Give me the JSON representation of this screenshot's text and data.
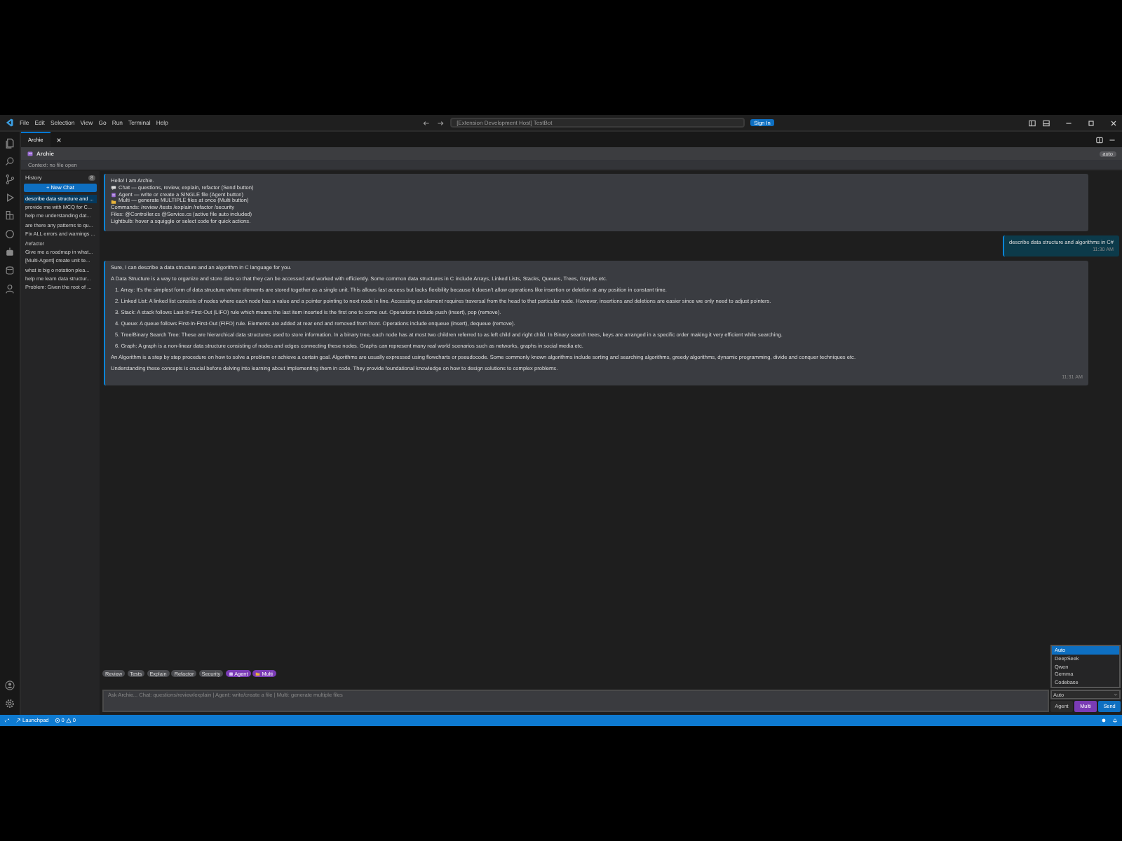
{
  "titlebar": {
    "menu": [
      "File",
      "Edit",
      "Selection",
      "View",
      "Go",
      "Run",
      "Terminal",
      "Help"
    ],
    "search": "[Extension Development Host] TestBot",
    "sign_in": "Sign In"
  },
  "tabs": [
    {
      "label": "Archie",
      "selected": true
    }
  ],
  "panel": {
    "title": "Archie",
    "badge": "auto",
    "context": "Context: no file open"
  },
  "history": {
    "title": "History",
    "count": "8",
    "new_chat": "+ New Chat",
    "items": [
      {
        "label": "describe data structure and ...",
        "selected": true
      },
      {
        "label": "provide me with MCQ for C...",
        "selected": false
      },
      {
        "label": "help me understanding dat...",
        "selected": false
      },
      {
        "label": "are there any patterns to qu...",
        "selected": false
      },
      {
        "label": "Fix ALL errors and warnings ...",
        "selected": false
      },
      {
        "label": "/refactor",
        "selected": false
      },
      {
        "label": "Give me a roadmap in what...",
        "selected": false
      },
      {
        "label": "[Multi-Agent] create unit te...",
        "selected": false
      },
      {
        "label": "what is big o notation plea...",
        "selected": false
      },
      {
        "label": "help me learn data structur...",
        "selected": false
      },
      {
        "label": "Problem: Given the root of ...",
        "selected": false
      }
    ]
  },
  "messages": [
    {
      "kind": "assistant",
      "lines": [
        {
          "kind": "text",
          "text": "Hello! I am Archie."
        },
        {
          "kind": "chat",
          "text": "Chat — questions, review, explain, refactor (Send button)"
        },
        {
          "kind": "agent",
          "text": "Agent — write or create a SINGLE file (Agent button)"
        },
        {
          "kind": "multi",
          "text": "Multi — generate MULTIPLE files at once (Multi button)"
        },
        {
          "kind": "text",
          "text": "Commands: /review /tests /explain /refactor /security"
        },
        {
          "kind": "text",
          "text": "Files: @Controller.cs @Service.cs (active file auto included)"
        },
        {
          "kind": "text",
          "text": "Lightbulb: hover a squiggle or select code for quick actions."
        }
      ]
    },
    {
      "kind": "user",
      "lines": [
        {
          "kind": "text",
          "text": "describe data structure and algorithms in C#"
        }
      ],
      "time": "11:30 AM"
    },
    {
      "kind": "assistant",
      "lines": [
        {
          "kind": "para",
          "text": "Sure, I can describe a data structure and an algorithm in C language for you."
        },
        {
          "kind": "para",
          "text": "A Data Structure is a way to organize and store data so that they can be accessed and worked with efficiently. Some common data structures in C include Arrays, Linked Lists, Stacks, Queues, Trees, Graphs etc."
        },
        {
          "kind": "item",
          "text": "1. Array: It's the simplest form of data structure where elements are stored together as a single unit. This allows fast access but lacks flexibility because it doesn’t allow operations like insertion or deletion at any position in constant time."
        },
        {
          "kind": "item",
          "text": "2. Linked List: A linked list consists of nodes where each node has a value and a pointer pointing to next node in line. Accessing an element requires traversal from the head to that particular node. However, insertions and deletions are easier since we only need to adjust pointers."
        },
        {
          "kind": "item",
          "text": "3. Stack: A stack follows Last-In-First-Out (LIFO) rule which means the last item inserted is the first one to come out. Operations include push (insert), pop (remove)."
        },
        {
          "kind": "item",
          "text": "4. Queue: A queue follows First-In-First-Out (FIFO) rule. Elements are added at rear end and removed from front. Operations include enqueue (insert), dequeue (remove)."
        },
        {
          "kind": "item",
          "text": "5. Tree/Binary Search Tree: These are hierarchical data structures used to store information. In a binary tree, each node has at most two children referred to as left child and right child. In Binary search trees, keys are arranged in a specific order making it very efficient while searching."
        },
        {
          "kind": "item",
          "text": "6. Graph: A graph is a non-linear data structure consisting of nodes and edges connecting these nodes. Graphs can represent many real world scenarios such as networks, graphs in social media etc."
        },
        {
          "kind": "para",
          "text": "An Algorithm is a step by step procedure on how to solve a problem or achieve a certain goal. Algorithms are usually expressed using flowcharts or pseudocode. Some commonly known algorithms include sorting and searching algorithms, greedy algorithms, dynamic programming, divide and conquer techniques etc."
        },
        {
          "kind": "para",
          "text": "Understanding these concepts is crucial before delving into learning about implementing them in code. They provide foundational knowledge on how to design solutions to complex problems."
        }
      ],
      "time": "11:31 AM"
    }
  ],
  "chips": [
    {
      "label": "Review",
      "kind": "plain"
    },
    {
      "label": "Tests",
      "kind": "plain"
    },
    {
      "label": "Explain",
      "kind": "plain"
    },
    {
      "label": "Refactor",
      "kind": "plain"
    },
    {
      "label": "Security",
      "kind": "plain"
    },
    {
      "label": "Agent",
      "kind": "agent"
    },
    {
      "label": "Multi",
      "kind": "multi"
    }
  ],
  "composer": {
    "placeholder": "Ask Archie... Chat: questions/review/explain | Agent: write/create a file | Multi: generate multiple files"
  },
  "model_menu": {
    "options": [
      {
        "label": "Auto",
        "selected": true
      },
      {
        "label": "DeepSeek",
        "selected": false
      },
      {
        "label": "Qwen",
        "selected": false
      },
      {
        "label": "Gemma",
        "selected": false
      },
      {
        "label": "Codebase",
        "selected": false
      }
    ],
    "value": "Auto"
  },
  "actions": [
    {
      "label": "Agent",
      "kind": "plain"
    },
    {
      "label": "Multi",
      "kind": "multi"
    },
    {
      "label": "Send",
      "kind": "send"
    }
  ],
  "statusbar": {
    "launchpad": "Launchpad",
    "errors": "0",
    "warnings": "0"
  }
}
